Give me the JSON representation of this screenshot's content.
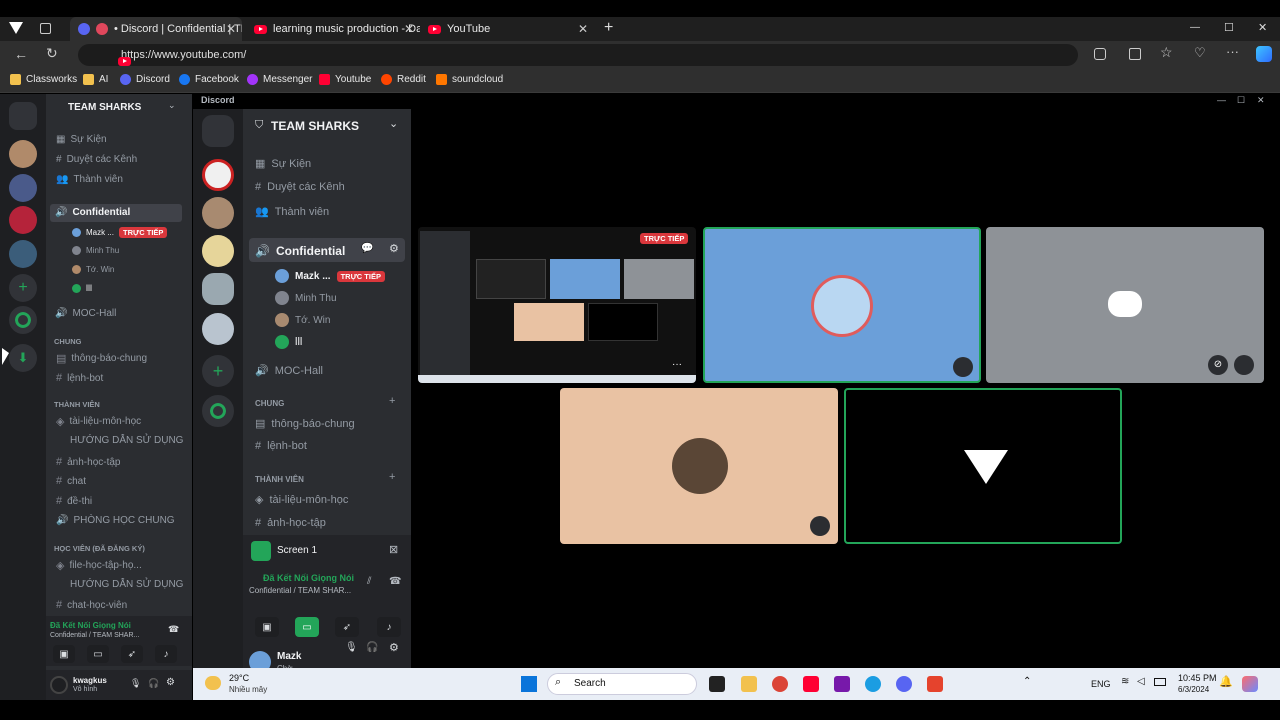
{
  "browser": {
    "tabs": [
      {
        "title": "• Discord | Confidential | TE/"
      },
      {
        "title": "learning music production - Day"
      },
      {
        "title": "YouTube"
      }
    ],
    "new_tab": "+",
    "url": "https://www.youtube.com/",
    "bookmarks": [
      "Classworks",
      "AI",
      "Discord",
      "Facebook",
      "Messenger",
      "Youtube",
      "Reddit",
      "soundcloud"
    ],
    "window_controls": {
      "min": "—",
      "max": "☐",
      "close": "✕"
    }
  },
  "outer": {
    "server_name": "TEAM SHARKS",
    "top_items": [
      "Sự Kiện",
      "Duyệt các Kênh",
      "Thành viên"
    ],
    "voice_channel": "Confidential",
    "live_badge": "TRỰC TIẾP",
    "members": [
      "Mazk ...",
      "Minh Thu",
      "Tớ. Win",
      "lll"
    ],
    "moc_hall": "MOC-Hall",
    "cat_chung": "CHUNG",
    "chung_channels": [
      "thông-báo-chung",
      "lệnh-bot"
    ],
    "cat_thanhvien": "THÀNH VIÊN",
    "thanhvien_channels": [
      "tài-liệu-môn-học",
      "HƯỚNG DẪN SỬ DỤNG",
      "ảnh-học-tập",
      "chat",
      "đề-thi",
      "PHÒNG HỌC CHUNG"
    ],
    "cat_hocvien": "HỌC VIÊN (ĐÃ ĐĂNG KÝ)",
    "hocvien_channels": [
      "file-học-tập-họ...",
      "HƯỚNG DẪN SỬ DỤNG",
      "chat-học-viên"
    ],
    "voice_status": "Đã Kết Nối Giọng Nói",
    "voice_sub": "Confidential / TEAM SHAR...",
    "user_name": "kwagkus",
    "user_status": "Vô hình"
  },
  "inner": {
    "app_title": "Discord",
    "server_name": "TEAM SHARKS",
    "top_items": [
      "Sự Kiện",
      "Duyệt các Kênh",
      "Thành viên"
    ],
    "voice_channel": "Confidential",
    "live_badge": "TRỰC TIẾP",
    "members": [
      "Mazk ...",
      "Minh Thu",
      "Tớ. Win",
      "lll"
    ],
    "moc_hall": "MOC-Hall",
    "cat_chung": "CHUNG",
    "chung_channels": [
      "thông-báo-chung",
      "lệnh-bot"
    ],
    "cat_thanhvien": "THÀNH VIÊN",
    "thanhvien_channels": [
      "tài-liệu-môn-học",
      "ảnh-học-tập"
    ],
    "screen_label": "Screen 1",
    "voice_status": "Đã Kết Nối Giọng Nói",
    "voice_sub": "Confidential / TEAM SHAR...",
    "user_name": "Mazk",
    "user_status": "Chờ",
    "stream_badge": "TRỰC TIẾP"
  },
  "taskbar": {
    "temp": "29°C",
    "weather": "Nhiều mây",
    "search": "Search",
    "lang": "ENG",
    "time": "10:45 PM",
    "date": "6/3/2024"
  },
  "colors": {
    "accent_green": "#23a559",
    "live_red": "#da373c",
    "blurple": "#5865f2",
    "tile_blue": "#6b9fd9",
    "tile_peach": "#e9c2a3"
  }
}
